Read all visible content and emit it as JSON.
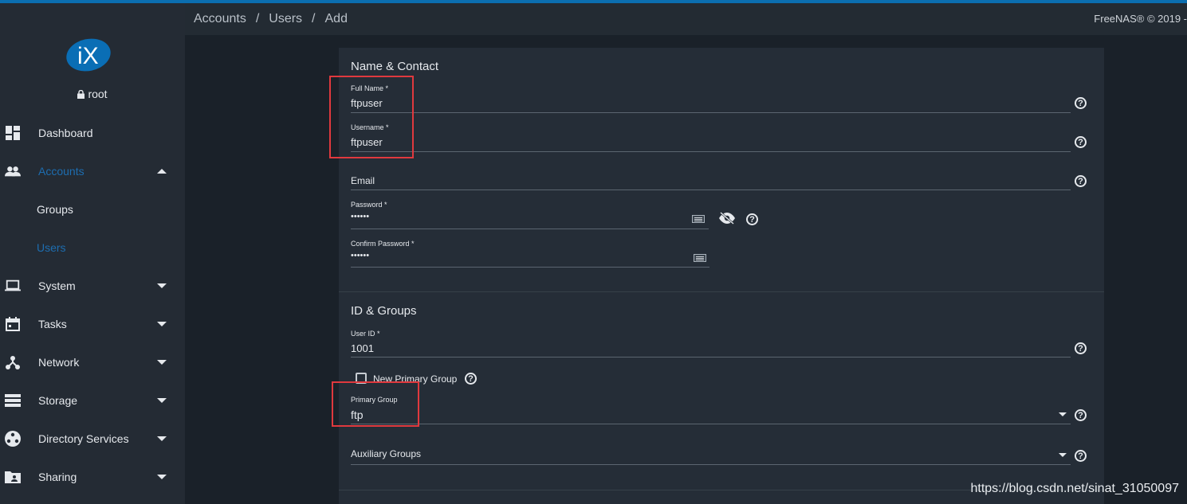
{
  "header": {
    "breadcrumb": [
      "Accounts",
      "Users",
      "Add"
    ],
    "separator": "/",
    "copyright": "FreeNAS® © 2019 -"
  },
  "sidebar": {
    "logo_text": "iX",
    "user": "root",
    "items": [
      {
        "label": "Dashboard",
        "icon": "dashboard-icon"
      },
      {
        "label": "Accounts",
        "icon": "people-icon",
        "active": true
      },
      {
        "label": "Groups"
      },
      {
        "label": "Users",
        "active": true
      },
      {
        "label": "System",
        "icon": "laptop-icon"
      },
      {
        "label": "Tasks",
        "icon": "calendar-icon"
      },
      {
        "label": "Network",
        "icon": "network-icon"
      },
      {
        "label": "Storage",
        "icon": "storage-icon"
      },
      {
        "label": "Directory Services",
        "icon": "directory-icon"
      },
      {
        "label": "Sharing",
        "icon": "sharing-icon"
      }
    ]
  },
  "form": {
    "name_contact": {
      "title": "Name & Contact",
      "full_name_label": "Full Name *",
      "full_name_value": "ftpuser",
      "username_label": "Username *",
      "username_value": "ftpuser",
      "email_label": "Email",
      "password_label": "Password *",
      "password_value": "••••••",
      "confirm_password_label": "Confirm Password *",
      "confirm_password_value": "••••••"
    },
    "id_groups": {
      "title": "ID & Groups",
      "user_id_label": "User ID *",
      "user_id_value": "1001",
      "new_primary_group_label": "New Primary Group",
      "primary_group_label": "Primary Group",
      "primary_group_value": "ftp",
      "auxiliary_groups_label": "Auxiliary Groups"
    }
  },
  "watermark": "https://blog.csdn.net/sinat_31050097",
  "colors": {
    "accent": "#1d6db0",
    "highlight": "#e0393e",
    "background": "#1a2129",
    "card": "#252d37"
  }
}
